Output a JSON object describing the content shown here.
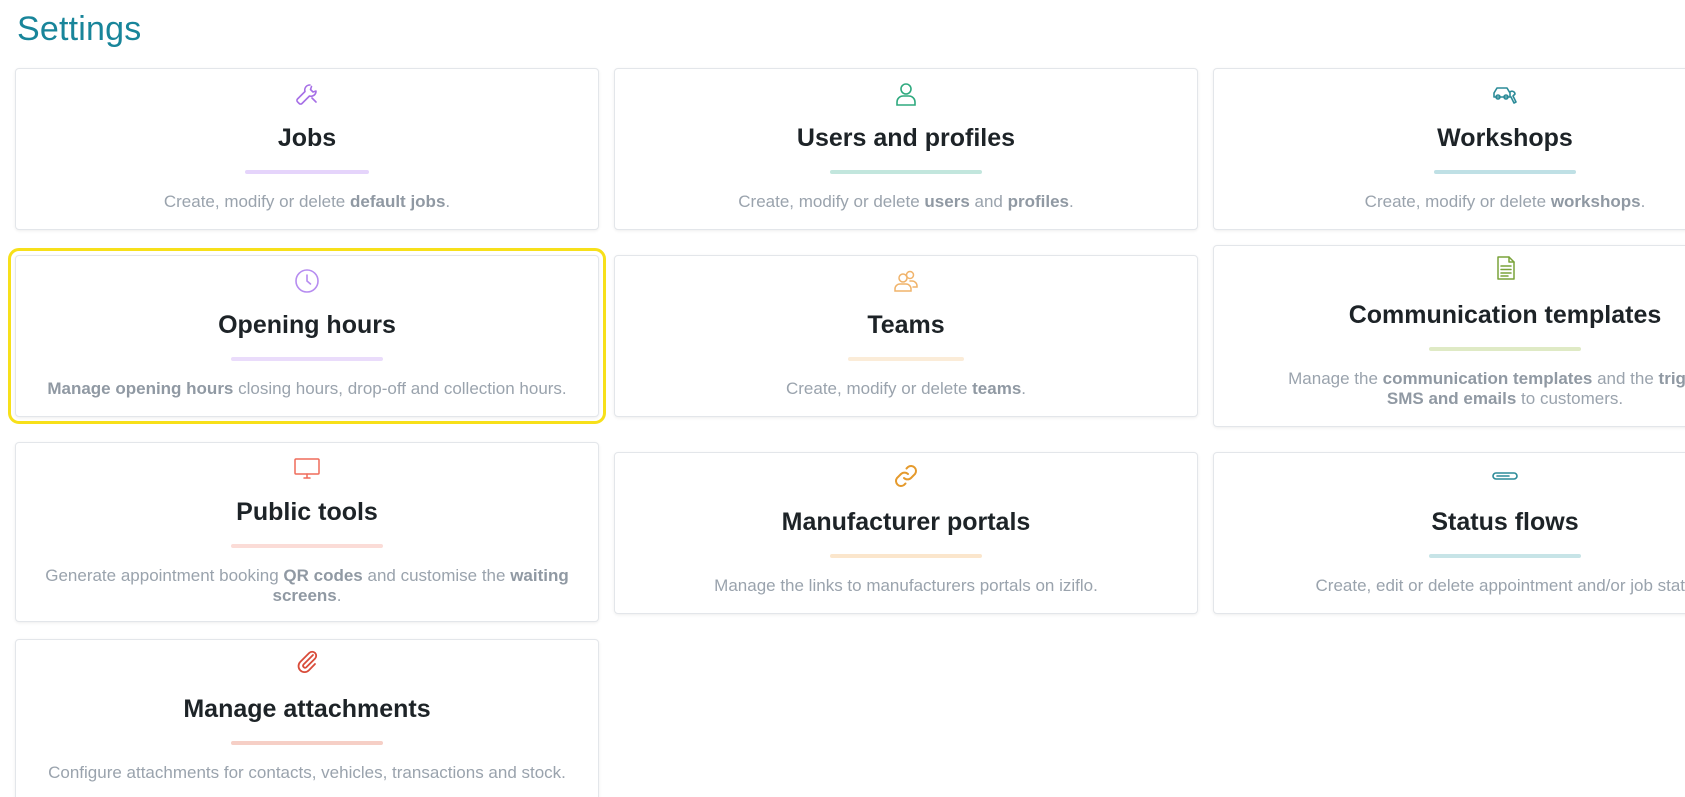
{
  "page": {
    "title": "Settings"
  },
  "cards": {
    "jobs": {
      "icon": "wrench-icon",
      "title": "Jobs",
      "desc_1": "Create, modify or delete ",
      "desc_2": "default jobs",
      "desc_3": ".",
      "accent": "#e5d4fb"
    },
    "users": {
      "icon": "user-icon",
      "title": "Users and profiles",
      "desc_1": "Create, modify or delete ",
      "desc_2": "users",
      "desc_3": " and ",
      "desc_4": "profiles",
      "desc_5": ".",
      "accent": "#c2e6dd"
    },
    "workshops": {
      "icon": "car-repair-icon",
      "title": "Workshops",
      "desc_1": "Create, modify or delete ",
      "desc_2": "workshops",
      "desc_3": ".",
      "accent": "#bfe0e5"
    },
    "opening_hours": {
      "icon": "clock-icon",
      "title": "Opening hours",
      "desc_1": "Manage opening hours",
      "desc_2": " closing hours, drop-off and collection hours.",
      "accent": "#eadcfb"
    },
    "teams": {
      "icon": "team-icon",
      "title": "Teams",
      "desc_1": "Create, modify or delete ",
      "desc_2": "teams",
      "desc_3": ".",
      "accent": "#fbecd8"
    },
    "communication": {
      "icon": "document-icon",
      "title": "Communication templates",
      "desc_1": "Manage the ",
      "desc_2": "communication templates",
      "desc_3": " and the ",
      "desc_4": "triggers",
      "desc_5": "SMS and emails",
      "desc_6": " to customers.",
      "accent": "#dfeac5"
    },
    "public_tools": {
      "icon": "monitor-icon",
      "title": "Public tools",
      "desc_1": "Generate appointment booking ",
      "desc_2": "QR codes",
      "desc_3": " and customise the ",
      "desc_4": "waiting",
      "desc_5": "screens",
      "desc_6": ".",
      "accent": "#fbdcd7"
    },
    "manufacturer": {
      "icon": "link-icon",
      "title": "Manufacturer portals",
      "desc_1": "Manage the links to manufacturers portals on iziflo.",
      "accent": "#fbe6cc"
    },
    "status_flows": {
      "icon": "status-bar-icon",
      "title": "Status flows",
      "desc_1": "Create, edit or delete appointment and/or job statu",
      "accent": "#c7e4e7"
    },
    "attachments": {
      "icon": "paperclip-icon",
      "title": "Manage attachments",
      "desc_1": "Configure attachments for contacts, vehicles, transactions and stock.",
      "accent": "#f6cfc6"
    }
  },
  "colors": {
    "title": "#18859a",
    "highlight": "#f7e01a",
    "jobs_icon": "#a66fe6",
    "users_icon": "#2faa7f",
    "workshops_icon": "#2c8b98",
    "opening_hours_icon": "#b68cf0",
    "teams_icon": "#f0b36a",
    "communication_icon": "#7aa33a",
    "public_tools_icon": "#ef6b5a",
    "manufacturer_icon": "#e59a2c",
    "status_flows_icon": "#2c8b98",
    "attachments_icon": "#d94c3a"
  }
}
